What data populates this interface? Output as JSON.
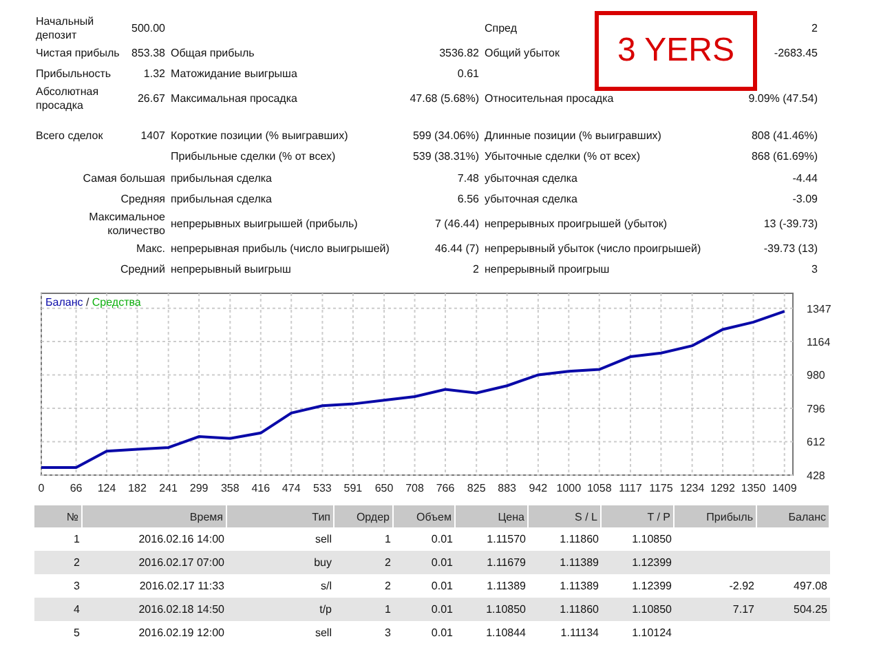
{
  "annotation": {
    "text": "3 YERS"
  },
  "stats": [
    [
      {
        "kind": "full",
        "label": "Начальный депозит",
        "value": "500.00",
        "label3": "Спред",
        "value3": "2"
      },
      {
        "kind": "full",
        "label": "Чистая прибыль",
        "value": "853.38",
        "label2": "Общая прибыль",
        "value2": "3536.82",
        "label3": "Общий убыток",
        "value3": "-2683.45"
      },
      {
        "kind": "full",
        "label": "Прибыльность",
        "value": "1.32",
        "label2": "Матожидание выигрыша",
        "value2": "0.61"
      },
      {
        "kind": "full",
        "label": "Абсолютная просадка",
        "value": "26.67",
        "label2": "Максимальная просадка",
        "value2": "47.68 (5.68%)",
        "label3": "Относительная просадка",
        "value3": "9.09% (47.54)"
      }
    ],
    [
      {
        "kind": "full",
        "label": "Всего сделок",
        "value": "1407",
        "label2": "Короткие позиции (% выигравших)",
        "value2": "599 (34.06%)",
        "label3": "Длинные позиции (% выигравших)",
        "value3": "808 (41.46%)"
      },
      {
        "kind": "full",
        "label2": "Прибыльные сделки (% от всех)",
        "value2": "539 (38.31%)",
        "label3": "Убыточные сделки (% от всех)",
        "value3": "868 (61.69%)"
      },
      {
        "kind": "span",
        "label": "Самая большая",
        "label2": "прибыльная сделка",
        "value2": "7.48",
        "label3": "убыточная сделка",
        "value3": "-4.44"
      },
      {
        "kind": "span",
        "label": "Средняя",
        "label2": "прибыльная сделка",
        "value2": "6.56",
        "label3": "убыточная сделка",
        "value3": "-3.09"
      },
      {
        "kind": "span",
        "label": "Максимальное количество",
        "label2": "непрерывных выигрышей (прибыль)",
        "value2": "7 (46.44)",
        "label3": "непрерывных проигрышей (убыток)",
        "value3": "13 (-39.73)"
      },
      {
        "kind": "span",
        "label": "Макс.",
        "label2": "непрерывная прибыль (число выигрышей)",
        "value2": "46.44 (7)",
        "label3": "непрерывный убыток (число проигрышей)",
        "value3": "-39.73 (13)"
      },
      {
        "kind": "span",
        "label": "Средний",
        "label2": "непрерывный выигрыш",
        "value2": "2",
        "label3": "непрерывный проигрыш",
        "value3": "3"
      }
    ]
  ],
  "chart": {
    "legend": [
      {
        "label": "Баланс",
        "color": "#0a0aa8"
      },
      {
        "label": "Средства",
        "color": "#10b010"
      }
    ],
    "legend_separator": "/",
    "chart_data": {
      "type": "line",
      "grid": true,
      "x": [
        0,
        66,
        124,
        182,
        241,
        299,
        358,
        416,
        474,
        533,
        591,
        650,
        708,
        766,
        825,
        883,
        942,
        1000,
        1058,
        1117,
        1175,
        1234,
        1292,
        1350,
        1409
      ],
      "series": [
        {
          "color": "#0a0aa8",
          "values": [
            470,
            470,
            560,
            570,
            580,
            640,
            630,
            660,
            770,
            810,
            820,
            840,
            860,
            900,
            880,
            920,
            980,
            1000,
            1010,
            1080,
            1100,
            1140,
            1230,
            1270,
            1330
          ]
        }
      ],
      "xlim": [
        0,
        1425
      ],
      "ylim": [
        428,
        1429
      ],
      "xticks": [
        0,
        66,
        124,
        182,
        241,
        299,
        358,
        416,
        474,
        533,
        591,
        650,
        708,
        766,
        825,
        883,
        942,
        1000,
        1058,
        1117,
        1175,
        1234,
        1292,
        1350,
        1409
      ],
      "yticks": [
        428,
        612,
        796,
        980,
        1164,
        1347
      ]
    }
  },
  "table": {
    "columns": [
      "№",
      "Время",
      "Тип",
      "Ордер",
      "Объем",
      "Цена",
      "S / L",
      "T / P",
      "Прибыль",
      "Баланс"
    ],
    "rows": [
      [
        "1",
        "2016.02.16 14:00",
        "sell",
        "1",
        "0.01",
        "1.11570",
        "1.11860",
        "1.10850",
        "",
        ""
      ],
      [
        "2",
        "2016.02.17 07:00",
        "buy",
        "2",
        "0.01",
        "1.11679",
        "1.11389",
        "1.12399",
        "",
        ""
      ],
      [
        "3",
        "2016.02.17 11:33",
        "s/l",
        "2",
        "0.01",
        "1.11389",
        "1.11389",
        "1.12399",
        "-2.92",
        "497.08"
      ],
      [
        "4",
        "2016.02.18 14:50",
        "t/p",
        "1",
        "0.01",
        "1.10850",
        "1.11860",
        "1.10850",
        "7.17",
        "504.25"
      ],
      [
        "5",
        "2016.02.19 12:00",
        "sell",
        "3",
        "0.01",
        "1.10844",
        "1.11134",
        "1.10124",
        "",
        ""
      ]
    ]
  }
}
